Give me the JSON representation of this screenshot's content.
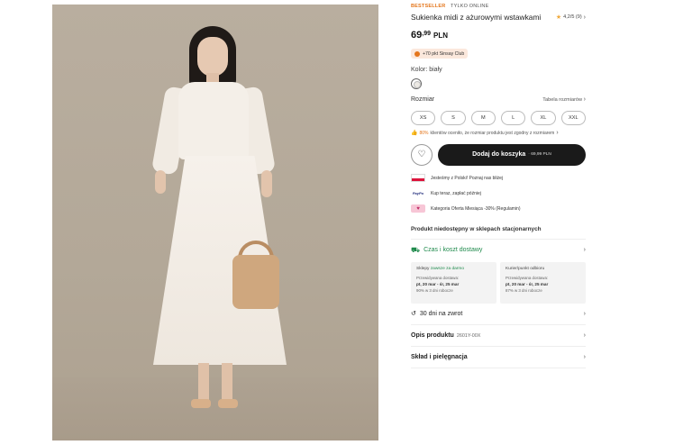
{
  "product": {
    "badge": "BESTSELLER",
    "tag": "TYLKO ONLINE",
    "title": "Sukienka midi z ażurowymi wstawkami",
    "rating_text": "4,2/5 (9)",
    "price_main": "69",
    "price_decimals": ",99",
    "currency": "PLN",
    "club_text": "+70 pkt Sinsay Club",
    "color_label": "Kolor: biały",
    "size_label": "Rozmiar",
    "size_table_link": "Tabela rozmiarów",
    "sizes": [
      "XS",
      "S",
      "M",
      "L",
      "XL",
      "XXL"
    ],
    "fit_pct": "80%",
    "fit_text": "klientów oceniło, że rozmiar produktu jest zgodny z rozmiarem",
    "add_to_cart": "Dodaj do koszyka",
    "button_price": "· 69,99 PLN"
  },
  "info": {
    "poland": "Jesteśmy z Polski! Poznaj nas bliżej",
    "paypo_logo": "PayPo",
    "paypo": "Kup teraz, zapłać później",
    "offer": "Kategoria Oferta Miesiąca -30% (Regulamin)"
  },
  "store_unavailable": "Produkt niedostępny w sklepach stacjonarnych",
  "delivery": {
    "title": "Czas i koszt dostawy",
    "stores": {
      "header": "Sklepy",
      "header_green": "zawsze za darmo",
      "label": "Przewidywana dostawa:",
      "dates": "pt, 20 mar - śr, 25 mar",
      "pct": "90% w 3 dni robocze"
    },
    "courier": {
      "header": "Kurier/punkt odbioru",
      "label": "Przewidywana dostawa:",
      "dates": "pt, 20 mar - śr, 25 mar",
      "pct": "87% w 3 dni robocze"
    }
  },
  "returns": "30 dni na zwrot",
  "description": {
    "label": "Opis produktu",
    "code": "2601Y-00X"
  },
  "care": "Skład i pielęgnacja",
  "colors": {
    "accent": "#e4761c",
    "green": "#1f8a4c",
    "button": "#1a1a1a"
  }
}
